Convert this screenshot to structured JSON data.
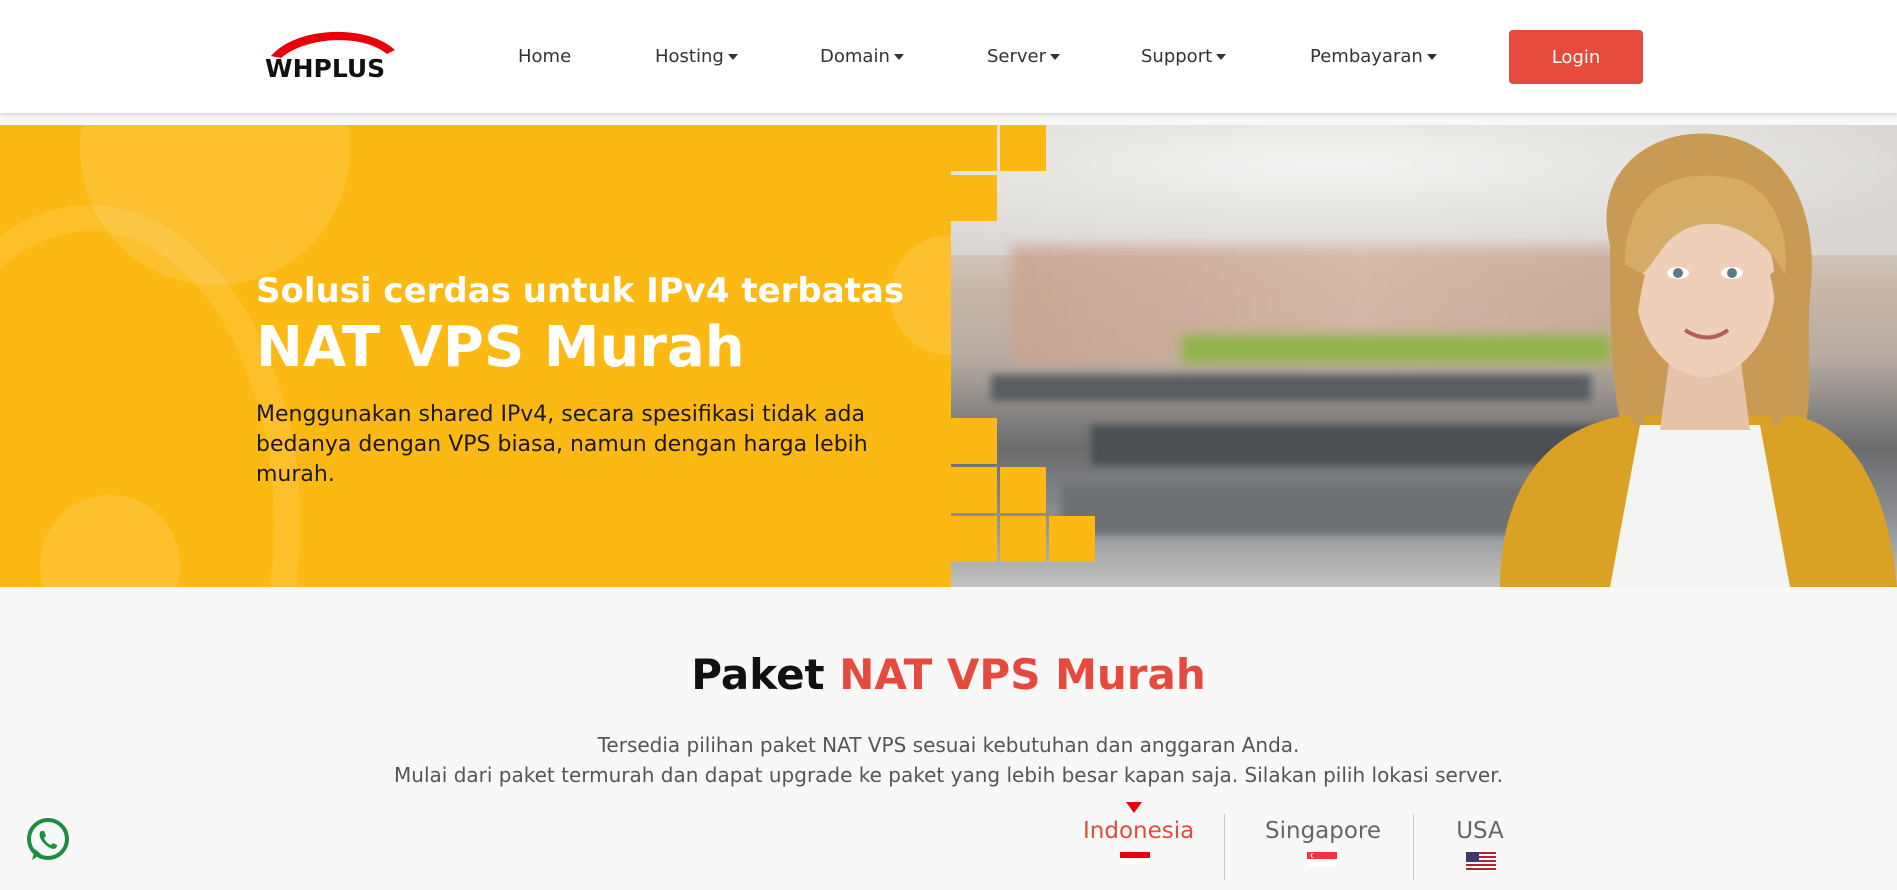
{
  "brand": {
    "name": "WHPLUS",
    "accent": "#e64a3c",
    "hero_bg": "#fdb913"
  },
  "nav": {
    "items": [
      {
        "label": "Home",
        "has_dropdown": false
      },
      {
        "label": "Hosting",
        "has_dropdown": true
      },
      {
        "label": "Domain",
        "has_dropdown": true
      },
      {
        "label": "Server",
        "has_dropdown": true
      },
      {
        "label": "Support",
        "has_dropdown": true
      },
      {
        "label": "Pembayaran",
        "has_dropdown": true
      }
    ],
    "login_label": "Login"
  },
  "hero": {
    "subtitle": "Solusi cerdas untuk IPv4 terbatas",
    "title": "NAT VPS Murah",
    "description": "Menggunakan shared IPv4, secara spesifikasi tidak ada bedanya dengan VPS biasa, namun dengan harga lebih murah."
  },
  "section": {
    "title_prefix": "Paket ",
    "title_accent": "NAT VPS Murah",
    "line1": "Tersedia pilihan paket NAT VPS sesuai kebutuhan dan anggaran Anda.",
    "line2": "Mulai dari paket termurah dan dapat upgrade ke paket yang lebih besar kapan saja. Silakan pilih lokasi server."
  },
  "locations": [
    {
      "label": "Indonesia",
      "flag": "indonesia-flag-icon",
      "active": true
    },
    {
      "label": "Singapore",
      "flag": "singapore-flag-icon",
      "active": false
    },
    {
      "label": "USA",
      "flag": "usa-flag-icon",
      "active": false
    }
  ],
  "floating": {
    "whatsapp_icon": "whatsapp-icon"
  }
}
